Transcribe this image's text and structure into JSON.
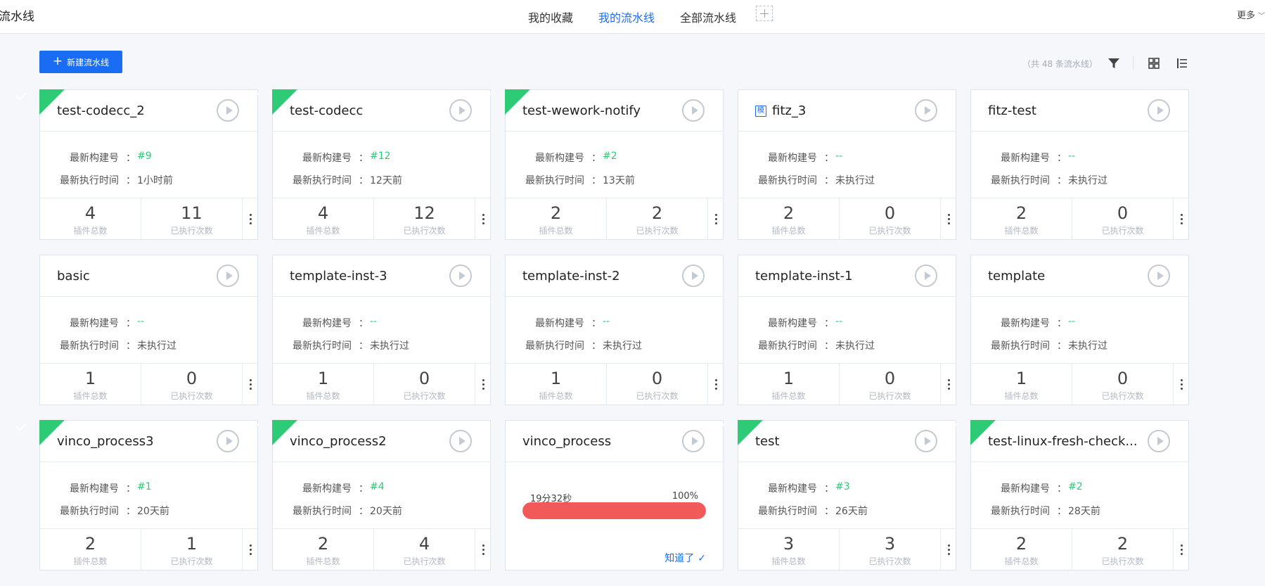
{
  "header": {
    "title": "流水线",
    "tabs": [
      {
        "label": "我的收藏",
        "active": false
      },
      {
        "label": "我的流水线",
        "active": true
      },
      {
        "label": "全部流水线",
        "active": false
      }
    ],
    "add_icon": "plus-icon",
    "more_label": "更多"
  },
  "toolbar": {
    "new_button_label": "新建流水线",
    "total_text": "（共 48 条流水线）",
    "icons": [
      "filter-icon",
      "grid-view-icon",
      "list-view-icon"
    ]
  },
  "labels": {
    "build_no": "最新构建号",
    "exec_time": "最新执行时间",
    "colon": "：",
    "plugin_total": "插件总数",
    "exec_count": "已执行次数",
    "template_badge": "模",
    "ack": "知道了"
  },
  "colors": {
    "accent": "#1a6df3",
    "success": "#2dcb76",
    "running": "#f25a5a"
  },
  "cards": [
    {
      "name": "test-codecc_2",
      "success": true,
      "template": false,
      "build_no": "#9",
      "exec_time": "1小时前",
      "plugins": "4",
      "runs": "11"
    },
    {
      "name": "test-codecc",
      "success": true,
      "template": false,
      "build_no": "#12",
      "exec_time": "12天前",
      "plugins": "4",
      "runs": "12"
    },
    {
      "name": "test-wework-notify",
      "success": true,
      "template": false,
      "build_no": "#2",
      "exec_time": "13天前",
      "plugins": "2",
      "runs": "2"
    },
    {
      "name": "fitz_3",
      "success": false,
      "template": true,
      "build_no": "--",
      "exec_time": "未执行过",
      "plugins": "2",
      "runs": "0"
    },
    {
      "name": "fitz-test",
      "success": false,
      "template": false,
      "build_no": "--",
      "exec_time": "未执行过",
      "plugins": "2",
      "runs": "0"
    },
    {
      "name": "basic",
      "success": false,
      "template": false,
      "build_no": "--",
      "exec_time": "未执行过",
      "plugins": "1",
      "runs": "0"
    },
    {
      "name": "template-inst-3",
      "success": false,
      "template": false,
      "build_no": "--",
      "exec_time": "未执行过",
      "plugins": "1",
      "runs": "0"
    },
    {
      "name": "template-inst-2",
      "success": false,
      "template": false,
      "build_no": "--",
      "exec_time": "未执行过",
      "plugins": "1",
      "runs": "0"
    },
    {
      "name": "template-inst-1",
      "success": false,
      "template": false,
      "build_no": "--",
      "exec_time": "未执行过",
      "plugins": "1",
      "runs": "0"
    },
    {
      "name": "template",
      "success": false,
      "template": false,
      "build_no": "--",
      "exec_time": "未执行过",
      "plugins": "1",
      "runs": "0"
    },
    {
      "name": "vinco_process3",
      "success": true,
      "template": false,
      "build_no": "#1",
      "exec_time": "20天前",
      "plugins": "2",
      "runs": "1"
    },
    {
      "name": "vinco_process2",
      "success": true,
      "template": false,
      "build_no": "#4",
      "exec_time": "20天前",
      "plugins": "2",
      "runs": "4"
    },
    {
      "name": "vinco_process",
      "success": false,
      "template": false,
      "running": true,
      "duration": "19分32秒",
      "progress_label": "100%",
      "progress": 1.0
    },
    {
      "name": "test",
      "success": true,
      "template": false,
      "build_no": "#3",
      "exec_time": "26天前",
      "plugins": "3",
      "runs": "3"
    },
    {
      "name": "test-linux-fresh-check...",
      "success": true,
      "template": false,
      "build_no": "#2",
      "exec_time": "28天前",
      "plugins": "2",
      "runs": "2"
    }
  ]
}
